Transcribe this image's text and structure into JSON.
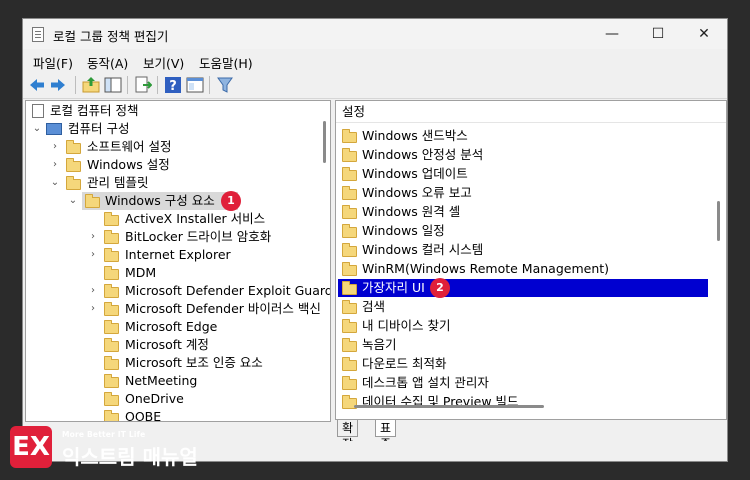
{
  "window": {
    "title": "로컬 그룹 정책 편집기",
    "controls": {
      "minimize": "—",
      "maximize": "☐",
      "close": "✕"
    }
  },
  "menu": [
    "파일(F)",
    "동작(A)",
    "보기(V)",
    "도움말(H)"
  ],
  "toolbar_icons": [
    "back-arrow-icon",
    "forward-arrow-icon",
    "up-folder-icon",
    "show-hide-tree-icon",
    "export-list-icon",
    "help-icon",
    "properties-view-icon",
    "filter-icon"
  ],
  "tree": {
    "root": "로컬 컴퓨터 정책",
    "computer_config": "컴퓨터 구성",
    "software_settings": "소프트웨어 설정",
    "windows_settings": "Windows 설정",
    "admin_templates": "관리 템플릿",
    "windows_components": "Windows 구성 요소",
    "children": [
      {
        "label": "ActiveX Installer 서비스",
        "expandable": false
      },
      {
        "label": "BitLocker 드라이브 암호화",
        "expandable": true
      },
      {
        "label": "Internet Explorer",
        "expandable": true
      },
      {
        "label": "MDM",
        "expandable": false
      },
      {
        "label": "Microsoft Defender Exploit Guard",
        "expandable": true
      },
      {
        "label": "Microsoft Defender 바이러스 백신",
        "expandable": true
      },
      {
        "label": "Microsoft Edge",
        "expandable": false
      },
      {
        "label": "Microsoft 계정",
        "expandable": false
      },
      {
        "label": "Microsoft 보조 인증 요소",
        "expandable": false
      },
      {
        "label": "NetMeeting",
        "expandable": false
      },
      {
        "label": "OneDrive",
        "expandable": false
      },
      {
        "label": "OOBE",
        "expandable": false
      }
    ]
  },
  "badges": {
    "one": "1",
    "two": "2"
  },
  "list": {
    "header": "설정",
    "items": [
      "Windows 샌드박스",
      "Windows 안정성 분석",
      "Windows 업데이트",
      "Windows 오류 보고",
      "Windows 원격 셸",
      "Windows 일정",
      "Windows 컬러 시스템",
      "WinRM(Windows Remote Management)",
      "가장자리 UI",
      "검색",
      "내 디바이스 찾기",
      "녹음기",
      "다운로드 최적화",
      "데스크톱 앱 설치 관리자",
      "데이터 수집 및 Preview 빌드"
    ],
    "selected_index": 8
  },
  "tabs": [
    "확장",
    "표준"
  ],
  "colors": {
    "selection": "#0000d0",
    "badge": "#e0203a",
    "folder": "#f5d77b"
  },
  "watermark": {
    "small": "More Better IT Life",
    "main": "익스트림 매뉴얼",
    "mark": "EX"
  }
}
